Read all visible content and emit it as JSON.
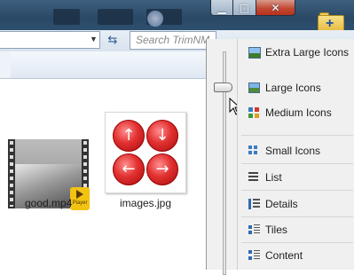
{
  "window": {
    "caption_minimize_icon": "minimize-icon",
    "caption_maximize_icon": "maximize-icon",
    "caption_close_icon": "close-icon"
  },
  "address_bar": {
    "search_placeholder": "Search TrimNM",
    "refresh_icon": "refresh-icon"
  },
  "files": [
    {
      "name": "good.mp4",
      "icon": "video-thumbnail-icon",
      "badge": "Player"
    },
    {
      "name": "images.jpg",
      "icon": "image-thumbnail-icon"
    }
  ],
  "view_menu": {
    "items": [
      {
        "label": "Extra Large Icons",
        "icon": "extra-large-icons-icon"
      },
      {
        "label": "Large Icons",
        "icon": "large-icons-icon"
      },
      {
        "label": "Medium Icons",
        "icon": "medium-icons-icon"
      },
      {
        "label": "Small Icons",
        "icon": "small-icons-icon"
      },
      {
        "label": "List",
        "icon": "list-icon"
      },
      {
        "label": "Details",
        "icon": "details-icon"
      },
      {
        "label": "Tiles",
        "icon": "tiles-icon"
      },
      {
        "label": "Content",
        "icon": "content-icon"
      }
    ],
    "selected": "Large Icons"
  },
  "images_glyphs": {
    "up": "↑",
    "down": "↓",
    "left": "←",
    "right": "→"
  },
  "colors": {
    "titlebar": "#2a4966",
    "close_button": "#c24a34",
    "menu_bg": "#f0f0f0"
  }
}
